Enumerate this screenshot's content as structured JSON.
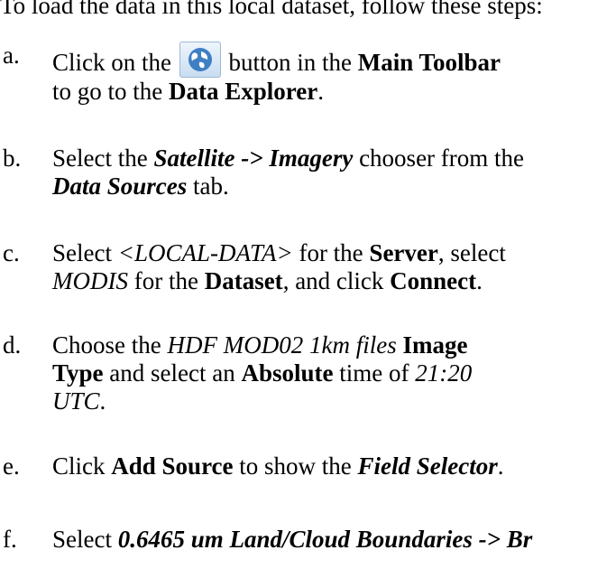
{
  "intro": "To load the data in this local dataset, follow these steps:",
  "steps": [
    {
      "letter": "a.",
      "l1_before": "Click on the",
      "l1_after": "button in the",
      "l1_bold": "Main Toolbar",
      "l2_before": "to go to the",
      "l2_bold": "Data Explorer",
      "l2_after": ".",
      "icon": "data-explorer-globe-icon"
    },
    {
      "letter": "b.",
      "l1_before": "Select the",
      "l1_bi": "Satellite -> Imagery",
      "l1_after": "chooser from the",
      "l2_bi": "Data Sources",
      "l2_after": "tab."
    },
    {
      "letter": "c.",
      "l1_before": "Select",
      "l1_i": "<LOCAL-DATA>",
      "l1_mid": "for the",
      "l1_bold": "Server",
      "l1_after": ", select",
      "l2_i": "MODIS",
      "l2_mid": "for the",
      "l2_bold": "Dataset",
      "l2_mid2": ", and click",
      "l2_bold2": "Connect",
      "l2_after": "."
    },
    {
      "letter": "d.",
      "l1_before": "Choose the",
      "l1_i": "HDF MOD02 1km files",
      "l1_bold": "Image",
      "l2_bold": "Type",
      "l2_mid": "and select an",
      "l2_bold2": "Absolute",
      "l2_after": "time of",
      "l2_i": "21:20",
      "l3_i": "UTC",
      "l3_after": "."
    },
    {
      "letter": "e.",
      "l1_before": "Click",
      "l1_bold": "Add Source",
      "l1_mid": "to show the",
      "l1_bi": "Field Selector",
      "l1_after": "."
    },
    {
      "letter": "f.",
      "l1_before": "Select",
      "l1_bi": "0.6465 um Land/Cloud Boundaries -> Br"
    }
  ]
}
